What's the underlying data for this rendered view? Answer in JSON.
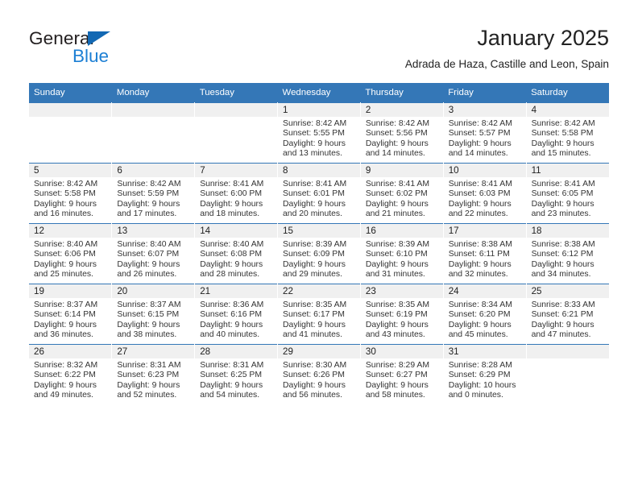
{
  "brand": {
    "name_top": "General",
    "name_bottom": "Blue",
    "triangle_color": "#1268b3",
    "blue_color": "#1c7fd4",
    "dark_color": "#231f20"
  },
  "header": {
    "title": "January 2025",
    "subtitle": "Adrada de Haza, Castille and Leon, Spain"
  },
  "theme": {
    "header_band": "#3477b7",
    "daynum_band": "#f0f0f0",
    "text": "#333333"
  },
  "weekday_headers": [
    "Sunday",
    "Monday",
    "Tuesday",
    "Wednesday",
    "Thursday",
    "Friday",
    "Saturday"
  ],
  "weeks": [
    [
      {
        "day": "",
        "empty": true,
        "lines": []
      },
      {
        "day": "",
        "empty": true,
        "lines": []
      },
      {
        "day": "",
        "empty": true,
        "lines": []
      },
      {
        "day": "1",
        "lines": [
          "Sunrise: 8:42 AM",
          "Sunset: 5:55 PM",
          "Daylight: 9 hours",
          "and 13 minutes."
        ]
      },
      {
        "day": "2",
        "lines": [
          "Sunrise: 8:42 AM",
          "Sunset: 5:56 PM",
          "Daylight: 9 hours",
          "and 14 minutes."
        ]
      },
      {
        "day": "3",
        "lines": [
          "Sunrise: 8:42 AM",
          "Sunset: 5:57 PM",
          "Daylight: 9 hours",
          "and 14 minutes."
        ]
      },
      {
        "day": "4",
        "lines": [
          "Sunrise: 8:42 AM",
          "Sunset: 5:58 PM",
          "Daylight: 9 hours",
          "and 15 minutes."
        ]
      }
    ],
    [
      {
        "day": "5",
        "lines": [
          "Sunrise: 8:42 AM",
          "Sunset: 5:58 PM",
          "Daylight: 9 hours",
          "and 16 minutes."
        ]
      },
      {
        "day": "6",
        "lines": [
          "Sunrise: 8:42 AM",
          "Sunset: 5:59 PM",
          "Daylight: 9 hours",
          "and 17 minutes."
        ]
      },
      {
        "day": "7",
        "lines": [
          "Sunrise: 8:41 AM",
          "Sunset: 6:00 PM",
          "Daylight: 9 hours",
          "and 18 minutes."
        ]
      },
      {
        "day": "8",
        "lines": [
          "Sunrise: 8:41 AM",
          "Sunset: 6:01 PM",
          "Daylight: 9 hours",
          "and 20 minutes."
        ]
      },
      {
        "day": "9",
        "lines": [
          "Sunrise: 8:41 AM",
          "Sunset: 6:02 PM",
          "Daylight: 9 hours",
          "and 21 minutes."
        ]
      },
      {
        "day": "10",
        "lines": [
          "Sunrise: 8:41 AM",
          "Sunset: 6:03 PM",
          "Daylight: 9 hours",
          "and 22 minutes."
        ]
      },
      {
        "day": "11",
        "lines": [
          "Sunrise: 8:41 AM",
          "Sunset: 6:05 PM",
          "Daylight: 9 hours",
          "and 23 minutes."
        ]
      }
    ],
    [
      {
        "day": "12",
        "lines": [
          "Sunrise: 8:40 AM",
          "Sunset: 6:06 PM",
          "Daylight: 9 hours",
          "and 25 minutes."
        ]
      },
      {
        "day": "13",
        "lines": [
          "Sunrise: 8:40 AM",
          "Sunset: 6:07 PM",
          "Daylight: 9 hours",
          "and 26 minutes."
        ]
      },
      {
        "day": "14",
        "lines": [
          "Sunrise: 8:40 AM",
          "Sunset: 6:08 PM",
          "Daylight: 9 hours",
          "and 28 minutes."
        ]
      },
      {
        "day": "15",
        "lines": [
          "Sunrise: 8:39 AM",
          "Sunset: 6:09 PM",
          "Daylight: 9 hours",
          "and 29 minutes."
        ]
      },
      {
        "day": "16",
        "lines": [
          "Sunrise: 8:39 AM",
          "Sunset: 6:10 PM",
          "Daylight: 9 hours",
          "and 31 minutes."
        ]
      },
      {
        "day": "17",
        "lines": [
          "Sunrise: 8:38 AM",
          "Sunset: 6:11 PM",
          "Daylight: 9 hours",
          "and 32 minutes."
        ]
      },
      {
        "day": "18",
        "lines": [
          "Sunrise: 8:38 AM",
          "Sunset: 6:12 PM",
          "Daylight: 9 hours",
          "and 34 minutes."
        ]
      }
    ],
    [
      {
        "day": "19",
        "lines": [
          "Sunrise: 8:37 AM",
          "Sunset: 6:14 PM",
          "Daylight: 9 hours",
          "and 36 minutes."
        ]
      },
      {
        "day": "20",
        "lines": [
          "Sunrise: 8:37 AM",
          "Sunset: 6:15 PM",
          "Daylight: 9 hours",
          "and 38 minutes."
        ]
      },
      {
        "day": "21",
        "lines": [
          "Sunrise: 8:36 AM",
          "Sunset: 6:16 PM",
          "Daylight: 9 hours",
          "and 40 minutes."
        ]
      },
      {
        "day": "22",
        "lines": [
          "Sunrise: 8:35 AM",
          "Sunset: 6:17 PM",
          "Daylight: 9 hours",
          "and 41 minutes."
        ]
      },
      {
        "day": "23",
        "lines": [
          "Sunrise: 8:35 AM",
          "Sunset: 6:19 PM",
          "Daylight: 9 hours",
          "and 43 minutes."
        ]
      },
      {
        "day": "24",
        "lines": [
          "Sunrise: 8:34 AM",
          "Sunset: 6:20 PM",
          "Daylight: 9 hours",
          "and 45 minutes."
        ]
      },
      {
        "day": "25",
        "lines": [
          "Sunrise: 8:33 AM",
          "Sunset: 6:21 PM",
          "Daylight: 9 hours",
          "and 47 minutes."
        ]
      }
    ],
    [
      {
        "day": "26",
        "lines": [
          "Sunrise: 8:32 AM",
          "Sunset: 6:22 PM",
          "Daylight: 9 hours",
          "and 49 minutes."
        ]
      },
      {
        "day": "27",
        "lines": [
          "Sunrise: 8:31 AM",
          "Sunset: 6:23 PM",
          "Daylight: 9 hours",
          "and 52 minutes."
        ]
      },
      {
        "day": "28",
        "lines": [
          "Sunrise: 8:31 AM",
          "Sunset: 6:25 PM",
          "Daylight: 9 hours",
          "and 54 minutes."
        ]
      },
      {
        "day": "29",
        "lines": [
          "Sunrise: 8:30 AM",
          "Sunset: 6:26 PM",
          "Daylight: 9 hours",
          "and 56 minutes."
        ]
      },
      {
        "day": "30",
        "lines": [
          "Sunrise: 8:29 AM",
          "Sunset: 6:27 PM",
          "Daylight: 9 hours",
          "and 58 minutes."
        ]
      },
      {
        "day": "31",
        "lines": [
          "Sunrise: 8:28 AM",
          "Sunset: 6:29 PM",
          "Daylight: 10 hours",
          "and 0 minutes."
        ]
      },
      {
        "day": "",
        "empty": true,
        "lines": []
      }
    ]
  ]
}
